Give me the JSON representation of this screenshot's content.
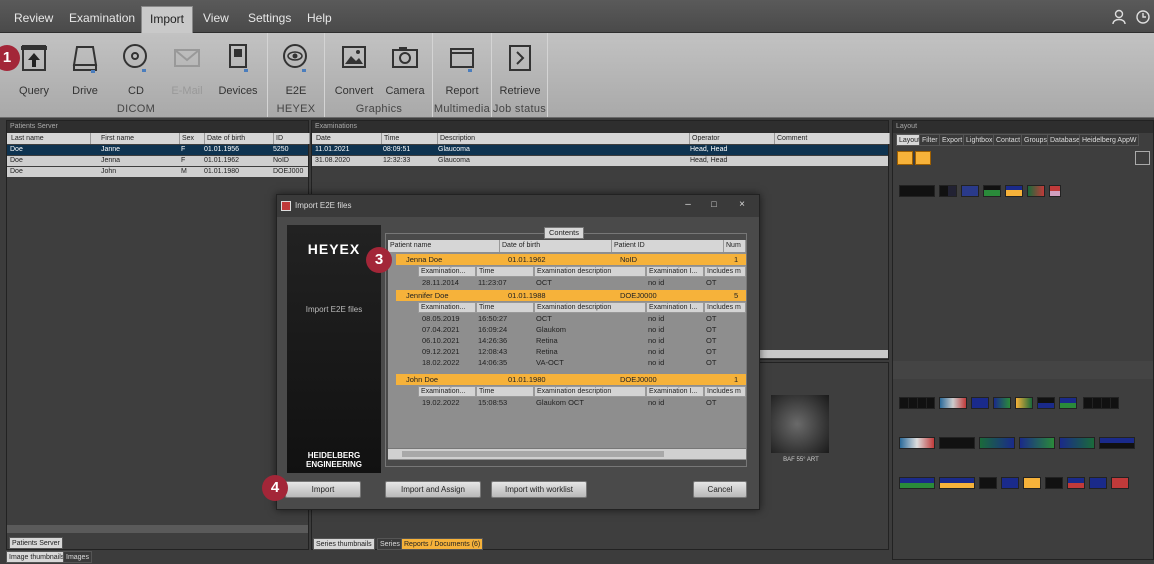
{
  "menubar": {
    "items": [
      "Review",
      "Examination",
      "Import",
      "View",
      "Settings",
      "Help"
    ],
    "active": "Import"
  },
  "ribbon": {
    "buttons": [
      {
        "label": "Query",
        "icon": "query-icon",
        "enabled": true
      },
      {
        "label": "Drive",
        "icon": "drive-icon",
        "enabled": true
      },
      {
        "label": "CD",
        "icon": "cd-icon",
        "enabled": true
      },
      {
        "label": "E-Mail",
        "icon": "email-icon",
        "enabled": false
      },
      {
        "label": "Devices",
        "icon": "devices-icon",
        "enabled": true
      },
      {
        "label": "E2E",
        "icon": "e2e-eye-icon",
        "enabled": true
      },
      {
        "label": "Convert",
        "icon": "convert-image-icon",
        "enabled": true
      },
      {
        "label": "Camera",
        "icon": "camera-icon",
        "enabled": true
      },
      {
        "label": "Report",
        "icon": "report-icon",
        "enabled": true
      },
      {
        "label": "Retrieve",
        "icon": "retrieve-icon",
        "enabled": true
      }
    ],
    "groups": [
      "DICOM",
      "HEYEX",
      "Graphics",
      "Multimedia",
      "Job status"
    ]
  },
  "badges": [
    "1",
    "3",
    "4"
  ],
  "patients_panel": {
    "title": "Patients Server",
    "columns": [
      "Last name",
      "First name",
      "Sex",
      "Date of birth",
      "ID"
    ],
    "rows": [
      [
        "Doe",
        "Janne",
        "F",
        "01.01.1956",
        "5250"
      ],
      [
        "Doe",
        "Jenna",
        "F",
        "01.01.1962",
        "NoID"
      ],
      [
        "Doe",
        "John",
        "M",
        "01.01.1980",
        "DOEJ000"
      ]
    ],
    "tab": "Patients Server"
  },
  "exams_panel": {
    "title": "Examinations",
    "columns": [
      "Date",
      "Time",
      "Description",
      "Operator",
      "Comment"
    ],
    "rows": [
      [
        "11.01.2021",
        "08:09:51",
        "Glaucoma",
        "Head, Head",
        ""
      ],
      [
        "31.08.2020",
        "12:32:33",
        "Glaucoma",
        "Head, Head",
        ""
      ]
    ]
  },
  "bottom_tabs": {
    "left": [
      "Image thumbnails",
      "Images"
    ],
    "middle": [
      "Series thumbnails",
      "Series",
      "Reports / Documents (6)"
    ]
  },
  "thumbnail_caption": "BAF 55° ART",
  "layout_panel": {
    "title": "Layout",
    "tabs": [
      "Layout",
      "Filter",
      "Export",
      "Lightbox",
      "Contact",
      "Groups",
      "Database",
      "Heidelberg AppW"
    ]
  },
  "dialog": {
    "title": "Import E2E files",
    "logo": "HEYEX",
    "subtitle": "Import E2E files",
    "brand_line1": "HEIDELBERG",
    "brand_line2": "ENGINEERING",
    "contents_label": "Contents",
    "columns": [
      "Patient name",
      "Date of birth",
      "Patient ID",
      "Num"
    ],
    "sub_columns": [
      "Examination...",
      "Time",
      "Examination description",
      "Examination I...",
      "Includes m"
    ],
    "patients": [
      {
        "name": "Jenna  Doe",
        "dob": "01.01.1962",
        "id": "NoID",
        "num": "1",
        "exams": [
          [
            "28.11.2014",
            "11:23:07",
            "OCT",
            "no id",
            "OT"
          ]
        ]
      },
      {
        "name": "Jennifer Doe",
        "dob": "01.01.1988",
        "id": "DOEJ0000",
        "num": "5",
        "exams": [
          [
            "08.05.2019",
            "16:50:27",
            "OCT",
            "no id",
            "OT"
          ],
          [
            "07.04.2021",
            "16:09:24",
            "Glaukom",
            "no id",
            "OT"
          ],
          [
            "06.10.2021",
            "14:26:36",
            "Retina",
            "no id",
            "OT"
          ],
          [
            "09.12.2021",
            "12:08:43",
            "Retina",
            "no id",
            "OT"
          ],
          [
            "18.02.2022",
            "14:06:35",
            "VA-OCT",
            "no id",
            "OT"
          ]
        ]
      },
      {
        "name": "John Doe",
        "dob": "01.01.1980",
        "id": "DOEJ0000",
        "num": "1",
        "exams": [
          [
            "19.02.2022",
            "15:08:53",
            "Glaukom OCT",
            "no id",
            "OT"
          ]
        ]
      }
    ],
    "buttons": {
      "import": "Import",
      "assign": "Import and Assign",
      "worklist": "Import with worklist",
      "cancel": "Cancel"
    }
  },
  "colors": {
    "accent": "#f6b23a",
    "badge": "#a32638",
    "selected": "#0e3350"
  }
}
